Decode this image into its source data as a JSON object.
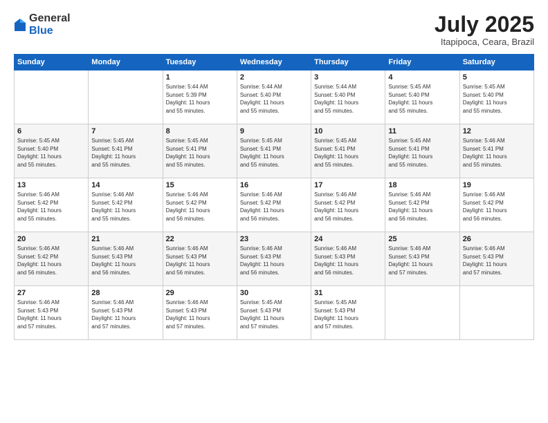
{
  "header": {
    "logo_general": "General",
    "logo_blue": "Blue",
    "month_title": "July 2025",
    "location": "Itapipoca, Ceara, Brazil"
  },
  "days_of_week": [
    "Sunday",
    "Monday",
    "Tuesday",
    "Wednesday",
    "Thursday",
    "Friday",
    "Saturday"
  ],
  "weeks": [
    [
      {
        "day": "",
        "info": ""
      },
      {
        "day": "",
        "info": ""
      },
      {
        "day": "1",
        "info": "Sunrise: 5:44 AM\nSunset: 5:39 PM\nDaylight: 11 hours\nand 55 minutes."
      },
      {
        "day": "2",
        "info": "Sunrise: 5:44 AM\nSunset: 5:40 PM\nDaylight: 11 hours\nand 55 minutes."
      },
      {
        "day": "3",
        "info": "Sunrise: 5:44 AM\nSunset: 5:40 PM\nDaylight: 11 hours\nand 55 minutes."
      },
      {
        "day": "4",
        "info": "Sunrise: 5:45 AM\nSunset: 5:40 PM\nDaylight: 11 hours\nand 55 minutes."
      },
      {
        "day": "5",
        "info": "Sunrise: 5:45 AM\nSunset: 5:40 PM\nDaylight: 11 hours\nand 55 minutes."
      }
    ],
    [
      {
        "day": "6",
        "info": "Sunrise: 5:45 AM\nSunset: 5:40 PM\nDaylight: 11 hours\nand 55 minutes."
      },
      {
        "day": "7",
        "info": "Sunrise: 5:45 AM\nSunset: 5:41 PM\nDaylight: 11 hours\nand 55 minutes."
      },
      {
        "day": "8",
        "info": "Sunrise: 5:45 AM\nSunset: 5:41 PM\nDaylight: 11 hours\nand 55 minutes."
      },
      {
        "day": "9",
        "info": "Sunrise: 5:45 AM\nSunset: 5:41 PM\nDaylight: 11 hours\nand 55 minutes."
      },
      {
        "day": "10",
        "info": "Sunrise: 5:45 AM\nSunset: 5:41 PM\nDaylight: 11 hours\nand 55 minutes."
      },
      {
        "day": "11",
        "info": "Sunrise: 5:45 AM\nSunset: 5:41 PM\nDaylight: 11 hours\nand 55 minutes."
      },
      {
        "day": "12",
        "info": "Sunrise: 5:46 AM\nSunset: 5:41 PM\nDaylight: 11 hours\nand 55 minutes."
      }
    ],
    [
      {
        "day": "13",
        "info": "Sunrise: 5:46 AM\nSunset: 5:42 PM\nDaylight: 11 hours\nand 55 minutes."
      },
      {
        "day": "14",
        "info": "Sunrise: 5:46 AM\nSunset: 5:42 PM\nDaylight: 11 hours\nand 55 minutes."
      },
      {
        "day": "15",
        "info": "Sunrise: 5:46 AM\nSunset: 5:42 PM\nDaylight: 11 hours\nand 56 minutes."
      },
      {
        "day": "16",
        "info": "Sunrise: 5:46 AM\nSunset: 5:42 PM\nDaylight: 11 hours\nand 56 minutes."
      },
      {
        "day": "17",
        "info": "Sunrise: 5:46 AM\nSunset: 5:42 PM\nDaylight: 11 hours\nand 56 minutes."
      },
      {
        "day": "18",
        "info": "Sunrise: 5:46 AM\nSunset: 5:42 PM\nDaylight: 11 hours\nand 56 minutes."
      },
      {
        "day": "19",
        "info": "Sunrise: 5:46 AM\nSunset: 5:42 PM\nDaylight: 11 hours\nand 56 minutes."
      }
    ],
    [
      {
        "day": "20",
        "info": "Sunrise: 5:46 AM\nSunset: 5:42 PM\nDaylight: 11 hours\nand 56 minutes."
      },
      {
        "day": "21",
        "info": "Sunrise: 5:46 AM\nSunset: 5:43 PM\nDaylight: 11 hours\nand 56 minutes."
      },
      {
        "day": "22",
        "info": "Sunrise: 5:46 AM\nSunset: 5:43 PM\nDaylight: 11 hours\nand 56 minutes."
      },
      {
        "day": "23",
        "info": "Sunrise: 5:46 AM\nSunset: 5:43 PM\nDaylight: 11 hours\nand 56 minutes."
      },
      {
        "day": "24",
        "info": "Sunrise: 5:46 AM\nSunset: 5:43 PM\nDaylight: 11 hours\nand 56 minutes."
      },
      {
        "day": "25",
        "info": "Sunrise: 5:46 AM\nSunset: 5:43 PM\nDaylight: 11 hours\nand 57 minutes."
      },
      {
        "day": "26",
        "info": "Sunrise: 5:46 AM\nSunset: 5:43 PM\nDaylight: 11 hours\nand 57 minutes."
      }
    ],
    [
      {
        "day": "27",
        "info": "Sunrise: 5:46 AM\nSunset: 5:43 PM\nDaylight: 11 hours\nand 57 minutes."
      },
      {
        "day": "28",
        "info": "Sunrise: 5:46 AM\nSunset: 5:43 PM\nDaylight: 11 hours\nand 57 minutes."
      },
      {
        "day": "29",
        "info": "Sunrise: 5:46 AM\nSunset: 5:43 PM\nDaylight: 11 hours\nand 57 minutes."
      },
      {
        "day": "30",
        "info": "Sunrise: 5:45 AM\nSunset: 5:43 PM\nDaylight: 11 hours\nand 57 minutes."
      },
      {
        "day": "31",
        "info": "Sunrise: 5:45 AM\nSunset: 5:43 PM\nDaylight: 11 hours\nand 57 minutes."
      },
      {
        "day": "",
        "info": ""
      },
      {
        "day": "",
        "info": ""
      }
    ]
  ]
}
